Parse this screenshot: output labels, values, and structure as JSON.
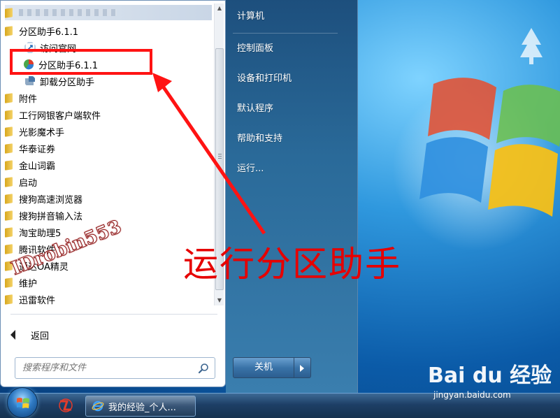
{
  "start_menu": {
    "programs": [
      {
        "label": "",
        "icon": "folder-icon",
        "type": "folder",
        "blurred": true
      },
      {
        "label": "分区助手6.1.1",
        "icon": "folder-icon",
        "type": "folder"
      },
      {
        "label": "访问官网",
        "icon": "link-icon",
        "type": "sub"
      },
      {
        "label": "分区助手6.1.1",
        "icon": "partition-app-icon",
        "type": "sub",
        "highlighted": true
      },
      {
        "label": "卸载分区助手",
        "icon": "uninstall-icon",
        "type": "sub"
      },
      {
        "label": "附件",
        "icon": "folder-icon",
        "type": "folder"
      },
      {
        "label": "工行网银客户端软件",
        "icon": "folder-icon",
        "type": "folder"
      },
      {
        "label": "光影魔术手",
        "icon": "folder-icon",
        "type": "folder"
      },
      {
        "label": "华泰证券",
        "icon": "folder-icon",
        "type": "folder"
      },
      {
        "label": "金山词霸",
        "icon": "folder-icon",
        "type": "folder"
      },
      {
        "label": "启动",
        "icon": "folder-icon",
        "type": "folder"
      },
      {
        "label": "搜狗高速浏览器",
        "icon": "folder-icon",
        "type": "folder"
      },
      {
        "label": "搜狗拼音输入法",
        "icon": "folder-icon",
        "type": "folder"
      },
      {
        "label": "淘宝助理5",
        "icon": "folder-icon",
        "type": "folder"
      },
      {
        "label": "腾讯软件",
        "icon": "folder-icon",
        "type": "folder"
      },
      {
        "label": "通达OA精灵",
        "icon": "folder-icon",
        "type": "folder"
      },
      {
        "label": "维护",
        "icon": "folder-icon",
        "type": "folder"
      },
      {
        "label": "迅雷软件",
        "icon": "folder-icon",
        "type": "folder"
      }
    ],
    "back_label": "返回",
    "search_placeholder": "搜索程序和文件",
    "right_items": [
      "计算机",
      "控制面板",
      "设备和打印机",
      "默认程序",
      "帮助和支持",
      "运行..."
    ],
    "shutdown_label": "关机"
  },
  "taskbar": {
    "window_button_label": "我的经验_个人..."
  },
  "annotation": {
    "text": "运行分区助手",
    "color": "#ff1313"
  },
  "watermark": {
    "id_text": "IDrobin553",
    "baidu_text": "Bai du 经验",
    "baidu_url": "jingyan.baidu.com"
  }
}
